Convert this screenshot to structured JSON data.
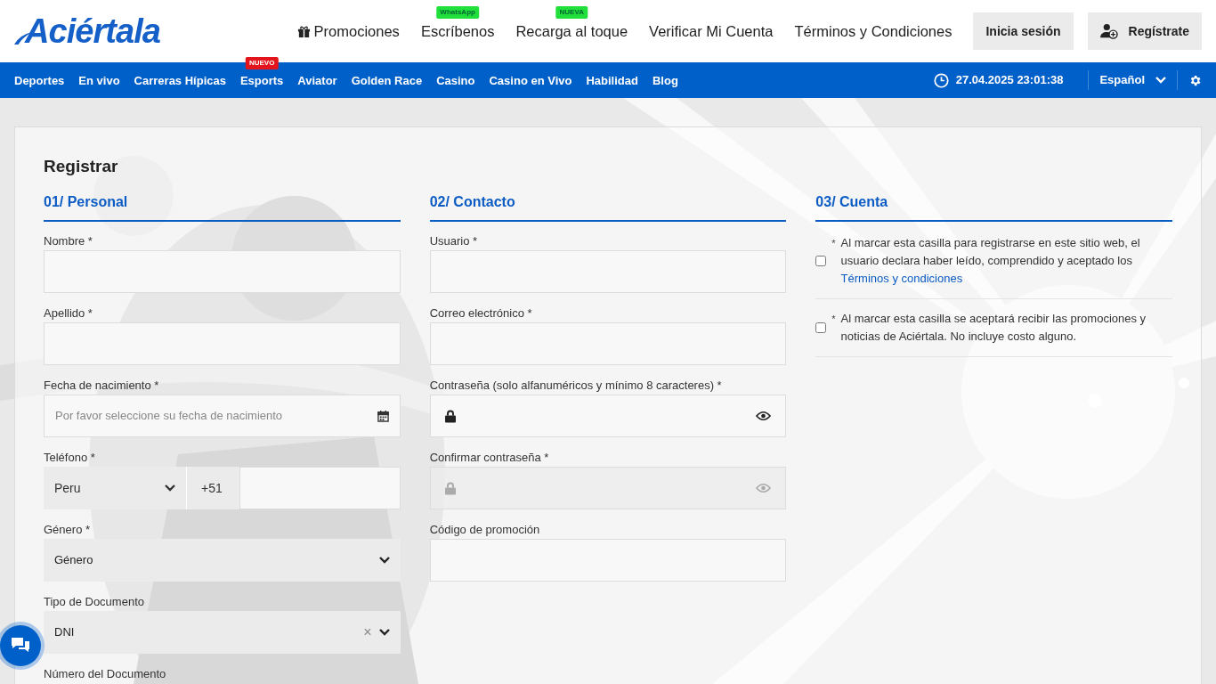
{
  "header": {
    "logo": "Aciértala",
    "links": [
      {
        "label": "Promociones"
      },
      {
        "label": "Escríbenos",
        "badge": "WhatsApp"
      },
      {
        "label": "Recarga al toque",
        "badge": "NUEVA"
      },
      {
        "label": "Verificar Mi Cuenta"
      },
      {
        "label": "Términos y Condiciones"
      }
    ],
    "login_button": "Inicia sesión",
    "register_button": "Regístrate"
  },
  "nav": {
    "items": [
      {
        "label": "Deportes"
      },
      {
        "label": "En vivo"
      },
      {
        "label": "Carreras Hípicas"
      },
      {
        "label": "Esports",
        "badge": "NUEVO"
      },
      {
        "label": "Aviator"
      },
      {
        "label": "Golden Race"
      },
      {
        "label": "Casino"
      },
      {
        "label": "Casino en Vivo"
      },
      {
        "label": "Habilidad"
      },
      {
        "label": "Blog"
      }
    ],
    "datetime": "27.04.2025 23:01:38",
    "language": "Español"
  },
  "form": {
    "title": "Registrar",
    "sections": [
      {
        "heading": "01/ Personal",
        "fields": [
          {
            "kind": "text",
            "label": "Nombre *"
          },
          {
            "kind": "text",
            "label": "Apellido *"
          },
          {
            "kind": "date",
            "label": "Fecha de nacimiento *",
            "placeholder": "Por favor seleccione su fecha de nacimiento"
          },
          {
            "kind": "phone",
            "label": "Teléfono *",
            "country": "Peru",
            "code": "+51"
          },
          {
            "kind": "select",
            "label": "Género *",
            "value": "Género"
          },
          {
            "kind": "select",
            "label": "Tipo de Documento",
            "value": "DNI",
            "clear": "×"
          },
          {
            "kind": "label",
            "label": "Número del Documento"
          }
        ]
      },
      {
        "heading": "02/ Contacto",
        "fields": [
          {
            "kind": "text",
            "label": "Usuario *"
          },
          {
            "kind": "text",
            "label": "Correo electrónico *"
          },
          {
            "kind": "password",
            "label": "Contraseña (solo alfanuméricos y mínimo 8 caracteres) *",
            "disabled": false
          },
          {
            "kind": "password",
            "label": "Confirmar contraseña *",
            "disabled": true
          },
          {
            "kind": "text",
            "label": "Código de promoción"
          }
        ]
      },
      {
        "heading": "03/ Cuenta",
        "fields": [
          {
            "kind": "checkbox",
            "mark": "*",
            "text": "Al marcar esta casilla para registrarse en este sitio web, el usuario declara haber leído, comprendido y aceptado los",
            "link": "Términos y condiciones",
            "checked": false
          },
          {
            "kind": "checkbox",
            "mark": "*",
            "text": "Al marcar esta casilla se aceptará recibir las promociones y noticias de Aciértala. No incluye costo alguno.",
            "checked": false
          }
        ]
      }
    ]
  }
}
